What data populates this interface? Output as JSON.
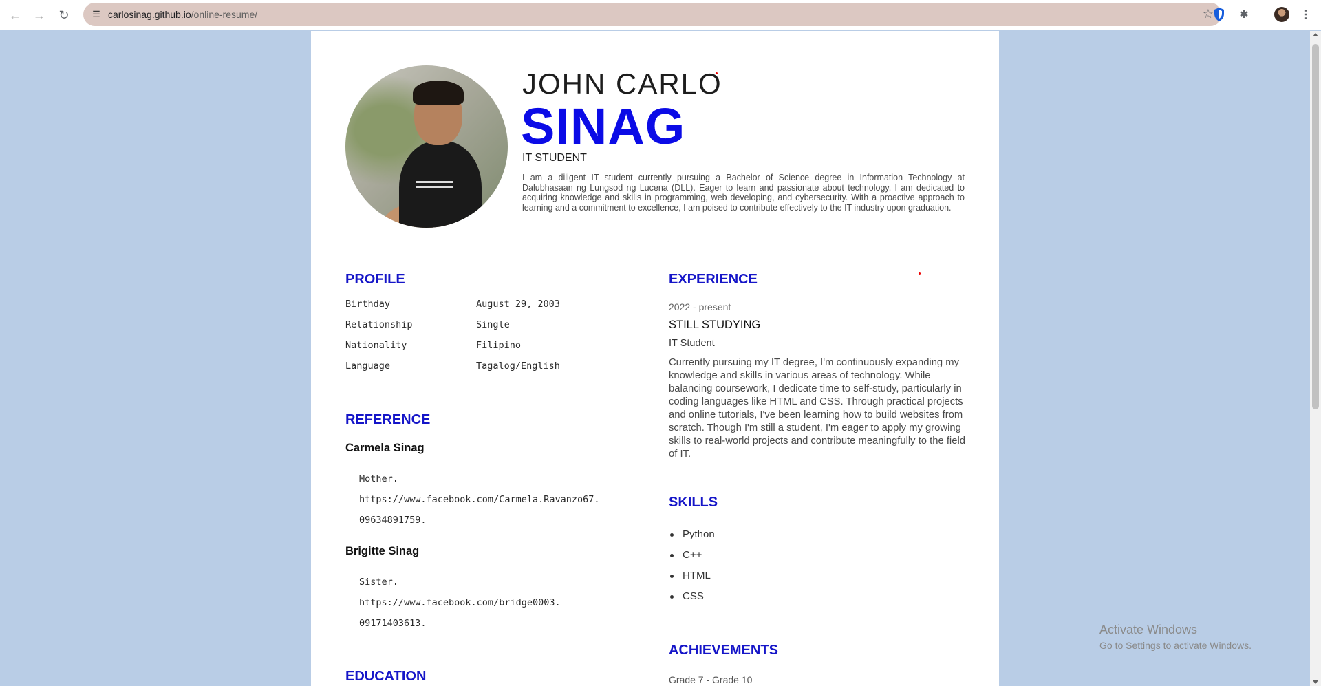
{
  "browser": {
    "url_host": "carlosinag.github.io",
    "url_path": "/online-resume/"
  },
  "header": {
    "first_name": "JOHN CARLO",
    "last_name": "SINAG",
    "role": "IT STUDENT",
    "intro": "I am a diligent IT student currently pursuing a Bachelor of Science degree in Information Technology at Dalubhasaan ng Lungsod ng Lucena (DLL). Eager to learn and passionate about technology, I am dedicated to acquiring knowledge and skills in programming, web developing, and cybersecurity. With a proactive approach to learning and a commitment to excellence, I am poised to contribute effectively to the IT industry upon graduation."
  },
  "profile": {
    "title": "PROFILE",
    "rows": [
      {
        "label": "Birthday",
        "value": "August 29, 2003"
      },
      {
        "label": "Relationship",
        "value": "Single"
      },
      {
        "label": "Nationality",
        "value": "Filipino"
      },
      {
        "label": "Language",
        "value": "Tagalog/English"
      }
    ]
  },
  "reference": {
    "title": "REFERENCE",
    "people": [
      {
        "name": "Carmela Sinag",
        "relation": "Mother.",
        "link": "https://www.facebook.com/Carmela.Ravanzo67.",
        "phone": "09634891759."
      },
      {
        "name": "Brigitte Sinag",
        "relation": "Sister.",
        "link": "https://www.facebook.com/bridge0003.",
        "phone": "09171403613."
      }
    ]
  },
  "education": {
    "title": "EDUCATION"
  },
  "experience": {
    "title": "EXPERIENCE",
    "date": "2022 - present",
    "heading": "STILL STUDYING",
    "role": "IT Student",
    "description": "Currently pursuing my IT degree, I'm continuously expanding my knowledge and skills in various areas of technology. While balancing coursework, I dedicate time to self-study, particularly in coding languages like HTML and CSS. Through practical projects and online tutorials, I've been learning how to build websites from scratch. Though I'm still a student, I'm eager to apply my growing skills to real-world projects and contribute meaningfully to the field of IT."
  },
  "skills": {
    "title": "SKILLS",
    "items": [
      "Python",
      "C++",
      "HTML",
      "CSS"
    ]
  },
  "achievements": {
    "title": "ACHIEVEMENTS",
    "first_date": "Grade 7 - Grade 10"
  },
  "watermark": {
    "line1": "Activate Windows",
    "line2": "Go to Settings to activate Windows."
  },
  "colors": {
    "accent": "#0b0be6",
    "section_heading": "#1515c8",
    "page_background": "#b9cde6"
  }
}
